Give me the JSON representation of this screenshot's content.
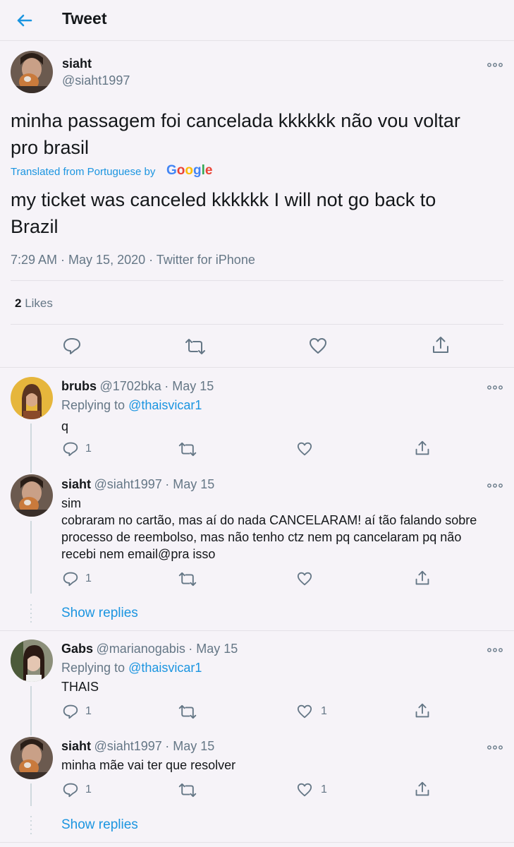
{
  "header": {
    "title": "Tweet",
    "back_icon": "arrow-left-icon"
  },
  "main_tweet": {
    "name": "siaht",
    "handle": "@siaht1997",
    "text_original_line1": "minha passagem foi cancelada kkkkkk não vou voltar",
    "text_original_line2": "pro brasil",
    "translated_label": "Translated from Portuguese by",
    "translator_logo": "Google",
    "text_translated_line1": "my ticket was canceled kkkkkk I will not go back to",
    "text_translated_line2": "Brazil",
    "timestamp": "7:29 AM · May 15, 2020 · Twitter for iPhone",
    "likes_count": "2",
    "likes_label": "Likes",
    "actions": [
      "reply-icon",
      "retweet-icon",
      "like-icon",
      "share-icon"
    ]
  },
  "replies": [
    {
      "name": "brubs",
      "handle": "@1702bka",
      "date": "· May 15",
      "replying_label": "Replying to",
      "replying_to": "@thaisvicar1",
      "lines": [
        "q"
      ],
      "reply_count": "1",
      "like_count": ""
    },
    {
      "name": "siaht",
      "handle": "@siaht1997",
      "date": "· May 15",
      "lines": [
        "sim",
        "cobraram no cartão, mas aí do nada CANCELARAM! aí tão falando sobre",
        "processo de reembolso, mas não tenho ctz nem pq cancelaram pq não",
        "recebi nem email@pra isso"
      ],
      "reply_count": "1",
      "like_count": "",
      "show_replies": "Show replies"
    },
    {
      "name": "Gabs",
      "handle": "@marianogabis",
      "date": "· May 15",
      "replying_label": "Replying to",
      "replying_to": "@thaisvicar1",
      "lines": [
        "THAIS"
      ],
      "reply_count": "1",
      "like_count": "1"
    },
    {
      "name": "siaht",
      "handle": "@siaht1997",
      "date": "· May 15",
      "lines": [
        "minha mãe vai ter que resolver"
      ],
      "reply_count": "1",
      "like_count": "1",
      "show_replies": "Show replies"
    }
  ],
  "colors": {
    "background": "#f6f3f8",
    "link": "#1b95e0",
    "secondary": "#657786"
  }
}
